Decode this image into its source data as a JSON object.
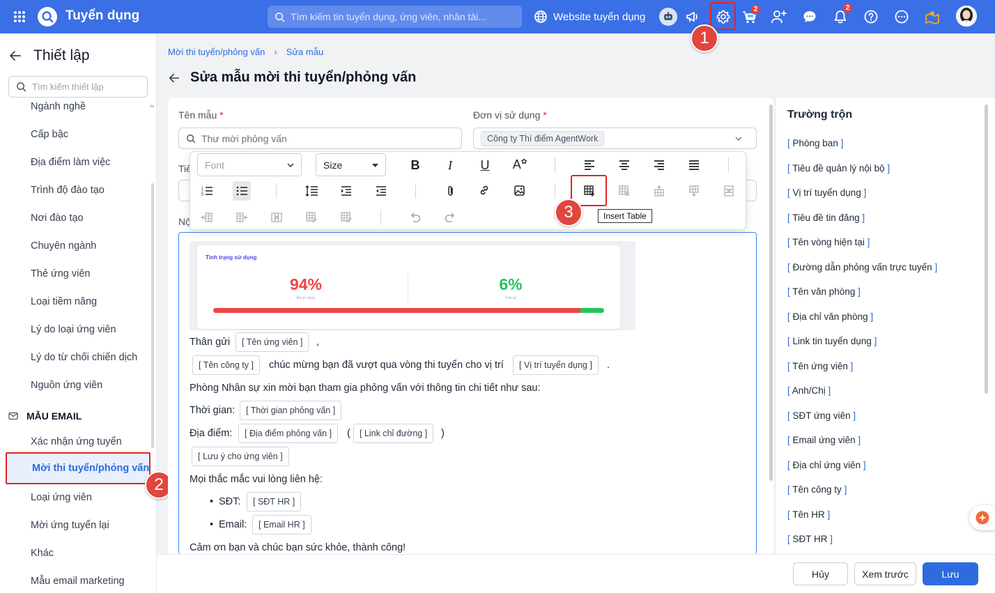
{
  "app": {
    "title": "Tuyển dụng",
    "search_placeholder": "Tìm kiếm tin tuyển dụng, ứng viên, nhân tài...",
    "website_label": "Website tuyển dụng",
    "cart_badge": "2",
    "bell_badge": "2"
  },
  "annotations": {
    "step1": "1",
    "step2": "2",
    "step3": "3"
  },
  "sidebar": {
    "title": "Thiết lập",
    "search_placeholder": "Tìm kiếm thiết lập",
    "items": [
      "Ngành nghề",
      "Cấp bậc",
      "Địa điểm làm việc",
      "Trình độ đào tạo",
      "Nơi đào tạo",
      "Chuyên ngành",
      "Thẻ ứng viên",
      "Loại tiềm năng",
      "Lý do loại ứng viên",
      "Lý do từ chối chiến dịch",
      "Nguồn ứng viên"
    ],
    "section_email": "MẪU EMAIL",
    "email_items": [
      "Xác nhận ứng tuyển",
      "Mời thi tuyển/phỏng vấn",
      "Loại ứng viên",
      "Mời ứng tuyển lại",
      "Khác",
      "Mẫu email marketing"
    ]
  },
  "breadcrumb": {
    "parent": "Mời thi tuyển/phỏng vấn",
    "current": "Sửa mẫu"
  },
  "page": {
    "title": "Sửa mẫu mời thi tuyển/phỏng vấn"
  },
  "form": {
    "name_label": "Tên mẫu",
    "name_required": "*",
    "name_placeholder": "Thư mời phỏng vấn",
    "unit_label": "Đơn vị sử dụng",
    "unit_required": "*",
    "unit_value": "Công ty Thí điểm AgentWork",
    "subject_label_partial": "Tiê",
    "content_label_partial": "Nộ"
  },
  "toolbar": {
    "font": "Font",
    "size": "Size",
    "tooltip": "Insert Table"
  },
  "editor": {
    "image": {
      "title": "Tình trạng sử dụng",
      "used_pct": "94%",
      "used_label": "Đã sử dụng",
      "remain_pct": "6%",
      "remain_label": "Còn lại",
      "used_fraction": 0.94,
      "used_color": "#ef4444",
      "remain_color": "#22c55e"
    },
    "greeting": "Thân gửi",
    "comma": ",",
    "congrats": "chúc mừng bạn đã vượt qua vòng thi tuyển cho vị trí",
    "period": ".",
    "invite": "Phòng Nhân sự xin mời bạn tham gia phỏng vấn với thông tin chi tiết như sau:",
    "time_label": "Thời gian:",
    "place_label": "Địa điểm:",
    "paren_open": "(",
    "paren_close": ")",
    "contact": "Mọi thắc mắc vui lòng liên hệ:",
    "phone_label": "SĐT:",
    "email_label": "Email:",
    "bullet": "•",
    "thanks": "Cảm ơn bạn và chúc bạn sức khỏe, thành công!",
    "fields": {
      "candidate": "[ Tên ứng viên ]",
      "company": "[ Tên công ty ]",
      "position": "[ Vị trí tuyển dụng ]",
      "time": "[ Thời gian phỏng vấn ]",
      "place": "[ Địa điểm phỏng vấn ]",
      "link": "[ Link chỉ đường ]",
      "note": "[ Lưu ý cho ứng viên ]",
      "hr_phone": "[ SĐT HR ]",
      "hr_email": "[ Email HR ]"
    }
  },
  "merge_fields": {
    "title": "Trường trộn",
    "items": [
      "Phòng ban",
      "Tiêu đề quản lý nội bộ",
      "Vị trí tuyển dụng",
      "Tiêu đề tin đăng",
      "Tên vòng hiện tại",
      "Đường dẫn phỏng vấn trực tuyến",
      "Tên văn phòng",
      "Địa chỉ văn phòng",
      "Link tin tuyển dụng",
      "Tên ứng viên",
      "Anh/Chị",
      "SĐT ứng viên",
      "Email ứng viên",
      "Địa chỉ ứng viên",
      "Tên công ty",
      "Tên HR",
      "SĐT HR"
    ]
  },
  "footer": {
    "cancel": "Hủy",
    "preview": "Xem trước",
    "save": "Lưu"
  }
}
